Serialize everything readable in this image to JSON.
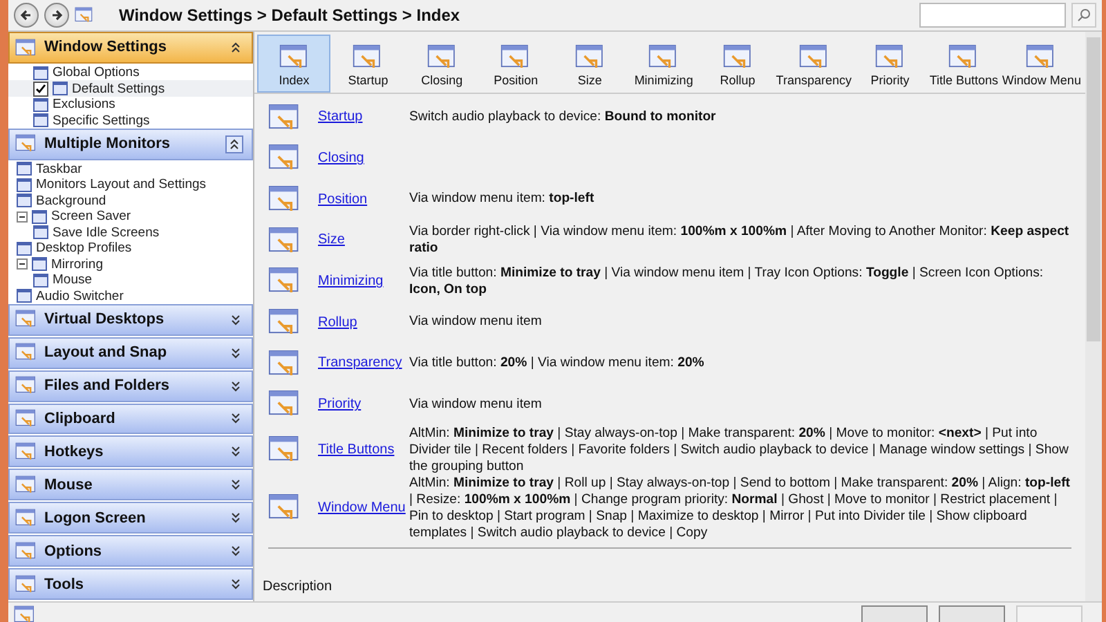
{
  "breadcrumb": "Window Settings > Default Settings > Index",
  "sidebar": {
    "groups": [
      {
        "title": "Window Settings",
        "expanded": true,
        "selected": true,
        "items": [
          {
            "label": "Global Options",
            "selected": false
          },
          {
            "label": "Default Settings",
            "selected": true
          },
          {
            "label": "Exclusions",
            "selected": false
          },
          {
            "label": "Specific Settings",
            "selected": false
          }
        ]
      },
      {
        "title": "Multiple Monitors",
        "expanded": true,
        "selected": false,
        "items": [
          {
            "label": "Taskbar",
            "selected": false
          },
          {
            "label": "Monitors Layout and Settings",
            "selected": false
          },
          {
            "label": "Background",
            "selected": false
          },
          {
            "label": "Screen Saver",
            "selected": false,
            "children": [
              {
                "label": "Save Idle Screens",
                "selected": false
              }
            ]
          },
          {
            "label": "Desktop Profiles",
            "selected": false
          },
          {
            "label": "Mirroring",
            "selected": false,
            "children": [
              {
                "label": "Mouse",
                "selected": false
              }
            ]
          },
          {
            "label": "Audio Switcher",
            "selected": false
          }
        ]
      },
      {
        "title": "Virtual Desktops",
        "expanded": false,
        "selected": false
      },
      {
        "title": "Layout and Snap",
        "expanded": false,
        "selected": false
      },
      {
        "title": "Files and Folders",
        "expanded": false,
        "selected": false
      },
      {
        "title": "Clipboard",
        "expanded": false,
        "selected": false
      },
      {
        "title": "Hotkeys",
        "expanded": false,
        "selected": false
      },
      {
        "title": "Mouse",
        "expanded": false,
        "selected": false
      },
      {
        "title": "Logon Screen",
        "expanded": false,
        "selected": false
      },
      {
        "title": "Options",
        "expanded": false,
        "selected": false
      },
      {
        "title": "Tools",
        "expanded": false,
        "selected": false
      }
    ]
  },
  "tabs": [
    {
      "label": "Index",
      "selected": true
    },
    {
      "label": "Startup",
      "selected": false
    },
    {
      "label": "Closing",
      "selected": false
    },
    {
      "label": "Position",
      "selected": false
    },
    {
      "label": "Size",
      "selected": false
    },
    {
      "label": "Minimizing",
      "selected": false
    },
    {
      "label": "Rollup",
      "selected": false
    },
    {
      "label": "Transparency",
      "selected": false
    },
    {
      "label": "Priority",
      "selected": false
    },
    {
      "label": "Title Buttons",
      "selected": false
    },
    {
      "label": "Window Menu",
      "selected": false
    }
  ],
  "rows": [
    {
      "link": "Startup",
      "text": "Switch audio playback to device: **Bound to monitor**"
    },
    {
      "link": "Closing"
    },
    {
      "link": "Position",
      "text": "Via window menu item: **top-left**"
    },
    {
      "link": "Size",
      "text": "Via border right-click | Via window menu item: **100%m x 100%m** | After Moving to Another Monitor: **Keep aspect ratio**"
    },
    {
      "link": "Minimizing",
      "text": "Via title button: **Minimize to tray** | Via window menu item | Tray Icon Options: **Toggle** | Screen Icon Options: **Icon, On top**"
    },
    {
      "link": "Rollup",
      "text": "Via window menu item"
    },
    {
      "link": "Transparency",
      "text": "Via title button: **20%** | Via window menu item: **20%**"
    },
    {
      "link": "Priority",
      "text": "Via window menu item"
    },
    {
      "link": "Title Buttons",
      "text": "AltMin: **Minimize to tray** | Stay always-on-top | Make transparent: **20%** | Move to monitor: **<next>** | Put into Divider tile | Recent folders | Favorite folders | Switch audio playback to device | Manage window settings | Show the grouping button"
    },
    {
      "link": "Window Menu",
      "text": "AltMin: **Minimize to tray** | Roll up | Stay always-on-top | Send to bottom | Make transparent: **20%** | Align: **top-left** | Resize: **100%m x 100%m** | Change program priority: **Normal** | Ghost | Move to monitor | Restrict placement | Pin to desktop | Start program | Snap | Maximize to desktop | Mirror | Put into Divider tile | Show clipboard templates | Switch audio playback to device | Copy"
    }
  ],
  "description": {
    "title": "Description"
  },
  "buttons": [
    {
      "disabled": false
    },
    {
      "disabled": false
    },
    {
      "disabled": true
    }
  ]
}
